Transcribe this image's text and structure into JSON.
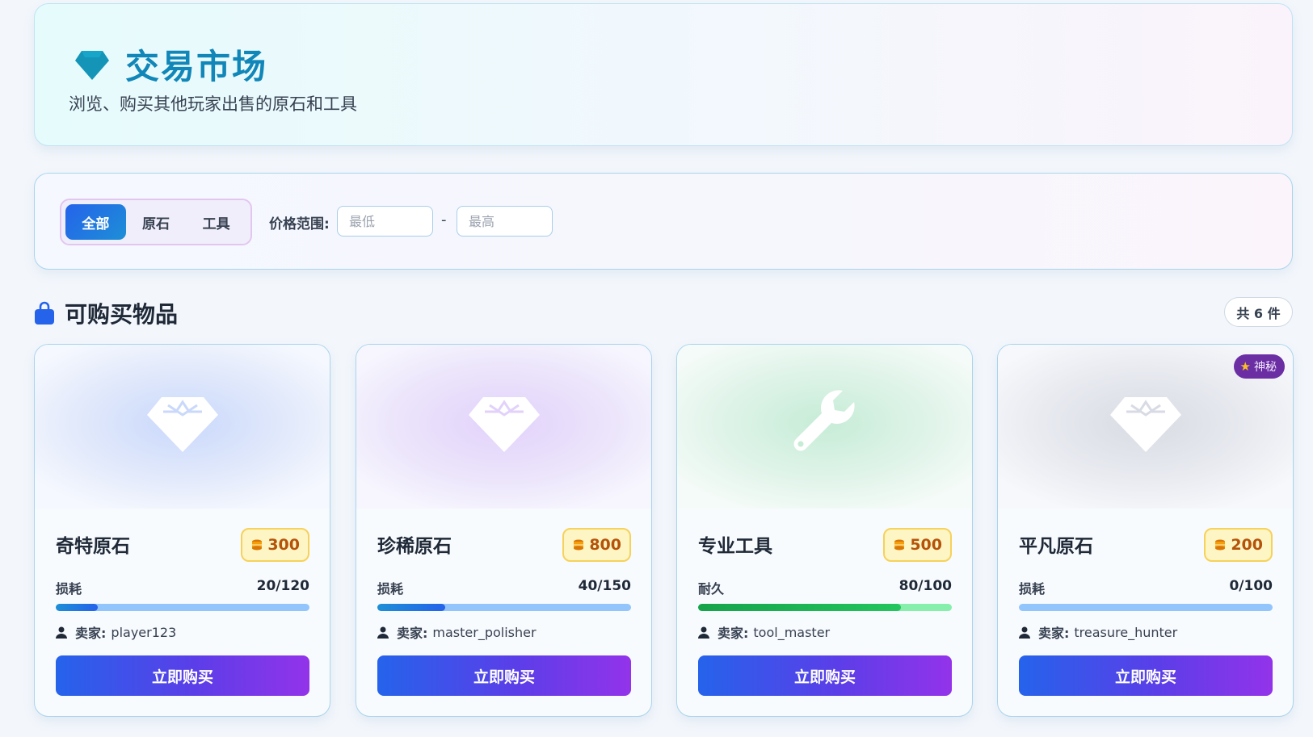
{
  "header": {
    "title": "交易市场",
    "subtitle": "浏览、购买其他玩家出售的原石和工具",
    "icon": "gem-icon",
    "accent_color": "#1186b8"
  },
  "filters": {
    "tabs": [
      {
        "label": "全部",
        "active": true
      },
      {
        "label": "原石",
        "active": false
      },
      {
        "label": "工具",
        "active": false
      }
    ],
    "price_label": "价格范围:",
    "min_placeholder": "最低",
    "max_placeholder": "最高",
    "separator": "-"
  },
  "section": {
    "title": "可购买物品",
    "icon": "shopping-bag-icon",
    "count_label": "共 6 件"
  },
  "items": [
    {
      "name": "奇特原石",
      "price": "300",
      "icon": "gem-icon",
      "stat_label": "损耗",
      "stat_value": "20/120",
      "progress": 0.1667,
      "seller_label": "卖家:",
      "seller": "player123",
      "buy_label": "立即购买",
      "tint": "#c9d8fb"
    },
    {
      "name": "珍稀原石",
      "price": "800",
      "icon": "gem-icon",
      "stat_label": "损耗",
      "stat_value": "40/150",
      "progress": 0.2667,
      "seller_label": "卖家:",
      "seller": "master_polisher",
      "buy_label": "立即购买",
      "tint": "#e2d2fb"
    },
    {
      "name": "专业工具",
      "price": "500",
      "icon": "wrench-icon",
      "stat_label": "耐久",
      "stat_value": "80/100",
      "progress": 0.8,
      "seller_label": "卖家:",
      "seller": "tool_master",
      "buy_label": "立即购买",
      "tint": "#c6ecd6"
    },
    {
      "name": "平凡原石",
      "price": "200",
      "icon": "gem-icon",
      "stat_label": "损耗",
      "stat_value": "0/100",
      "progress": 0,
      "seller_label": "卖家:",
      "seller": "treasure_hunter",
      "buy_label": "立即购买",
      "tint": "#d9dbe4",
      "badge": "神秘"
    }
  ],
  "colors": {
    "primary_blue": "#2563eb",
    "purple": "#9333ea",
    "gold": "#b45309",
    "badge_purple": "#6b2fa3"
  }
}
